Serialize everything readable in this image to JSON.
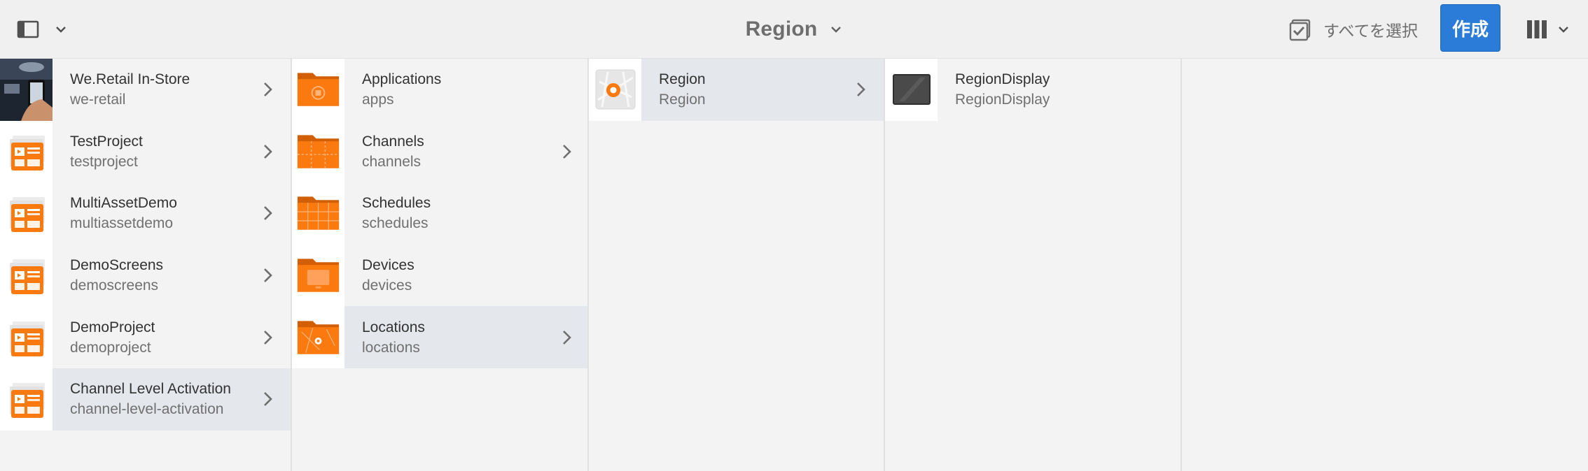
{
  "header": {
    "title": "Region",
    "select_all_label": "すべてを選択",
    "create_label": "作成",
    "accent_color": "#2b7bd8"
  },
  "columns": [
    {
      "items": [
        {
          "title": "We.Retail In-Store",
          "subtitle": "we-retail",
          "thumb": "photo-thumbnail",
          "has_children": true
        },
        {
          "title": "TestProject",
          "subtitle": "testproject",
          "thumb": "project-icon",
          "has_children": true
        },
        {
          "title": "MultiAssetDemo",
          "subtitle": "multiassetdemo",
          "thumb": "project-icon",
          "has_children": true
        },
        {
          "title": "DemoScreens",
          "subtitle": "demoscreens",
          "thumb": "project-icon",
          "has_children": true
        },
        {
          "title": "DemoProject",
          "subtitle": "demoproject",
          "thumb": "project-icon",
          "has_children": true
        },
        {
          "title": "Channel Level Activation",
          "subtitle": "channel-level-activation",
          "thumb": "project-icon",
          "has_children": true,
          "active": true
        }
      ]
    },
    {
      "items": [
        {
          "title": "Applications",
          "subtitle": "apps",
          "thumb": "applications-folder-icon",
          "has_children": false
        },
        {
          "title": "Channels",
          "subtitle": "channels",
          "thumb": "channels-folder-icon",
          "has_children": true
        },
        {
          "title": "Schedules",
          "subtitle": "schedules",
          "thumb": "schedules-folder-icon",
          "has_children": false
        },
        {
          "title": "Devices",
          "subtitle": "devices",
          "thumb": "devices-folder-icon",
          "has_children": false
        },
        {
          "title": "Locations",
          "subtitle": "locations",
          "thumb": "locations-folder-icon",
          "has_children": true,
          "active": true
        }
      ]
    },
    {
      "items": [
        {
          "title": "Region",
          "subtitle": "Region",
          "thumb": "map-pin-icon",
          "has_children": true,
          "active": true
        }
      ]
    },
    {
      "items": [
        {
          "title": "RegionDisplay",
          "subtitle": "RegionDisplay",
          "thumb": "display-icon",
          "has_children": false
        }
      ]
    }
  ]
}
